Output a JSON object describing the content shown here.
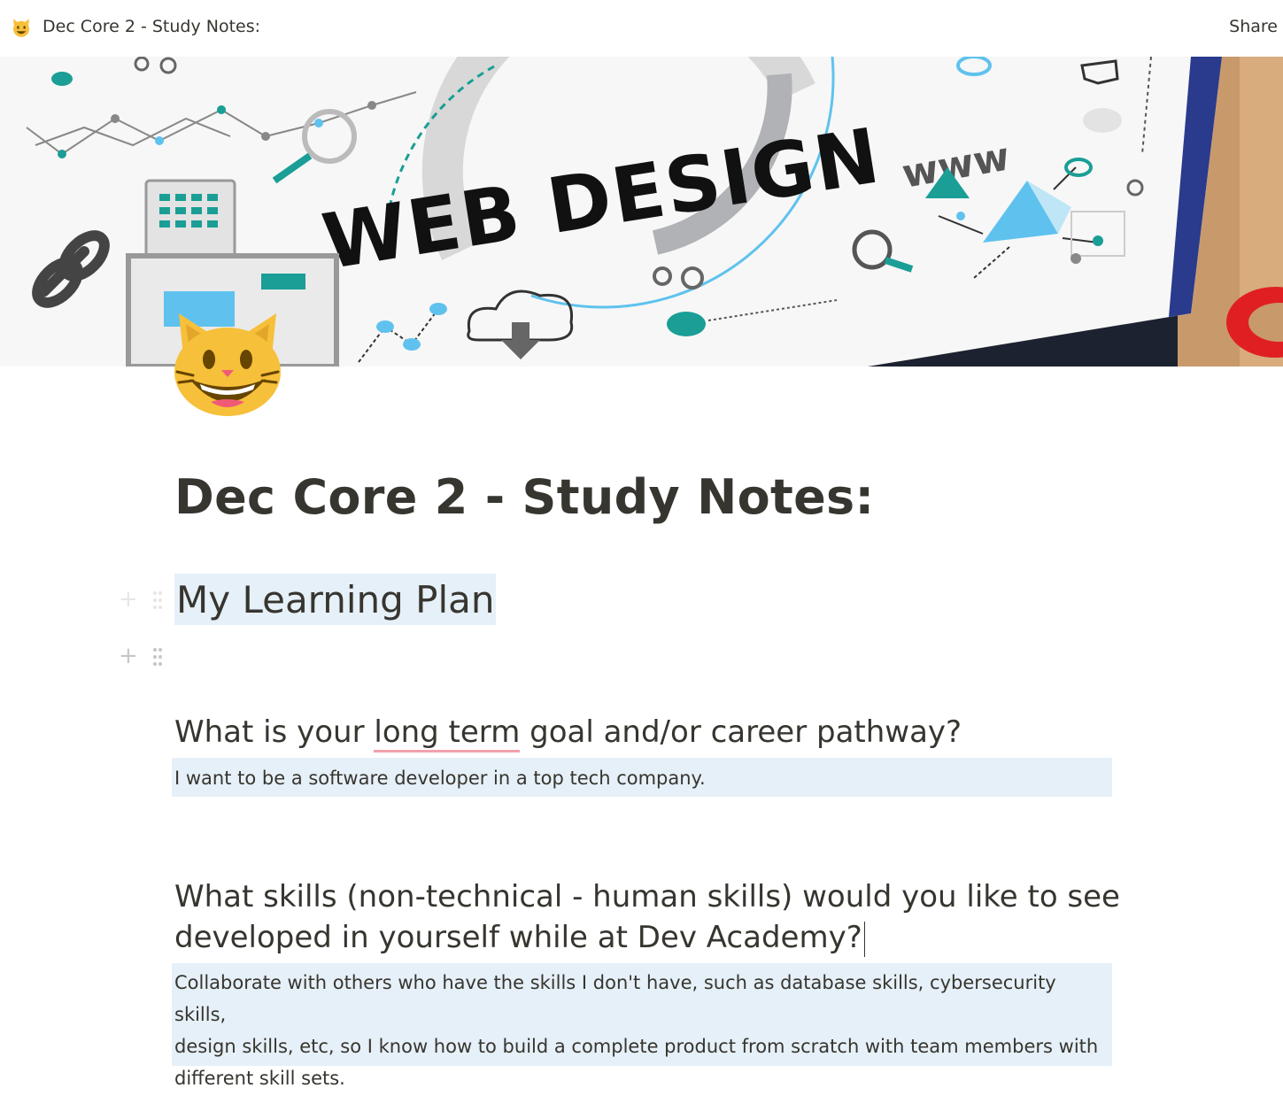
{
  "topbar": {
    "title": "Dec Core 2 - Study Notes:",
    "share_label": "Share",
    "icon": "smiling-cat-emoji"
  },
  "cover": {
    "headline": "WEB DESIGN",
    "www": "www",
    "accent": "#1a9e96",
    "blue": "#5fc2ee"
  },
  "page": {
    "icon": "smiling-cat-emoji",
    "title": "Dec Core 2 - Study Notes:",
    "heading": "My Learning Plan",
    "q1": {
      "before": "What is your ",
      "underlined": "long term",
      "after": " goal and/or career pathway?",
      "answer": "I want to be a software developer in a top tech company."
    },
    "q2": {
      "line1": "What skills (non-technical - human skills) would you like to see",
      "line2": "developed in yourself while at Dev Academy?",
      "answer_lines": [
        "Collaborate with others who have the skills I don't have, such as database skills, cybersecurity skills,",
        "design skills, etc, so I know how to build a complete product from scratch with team members with",
        "different skill sets."
      ]
    }
  }
}
